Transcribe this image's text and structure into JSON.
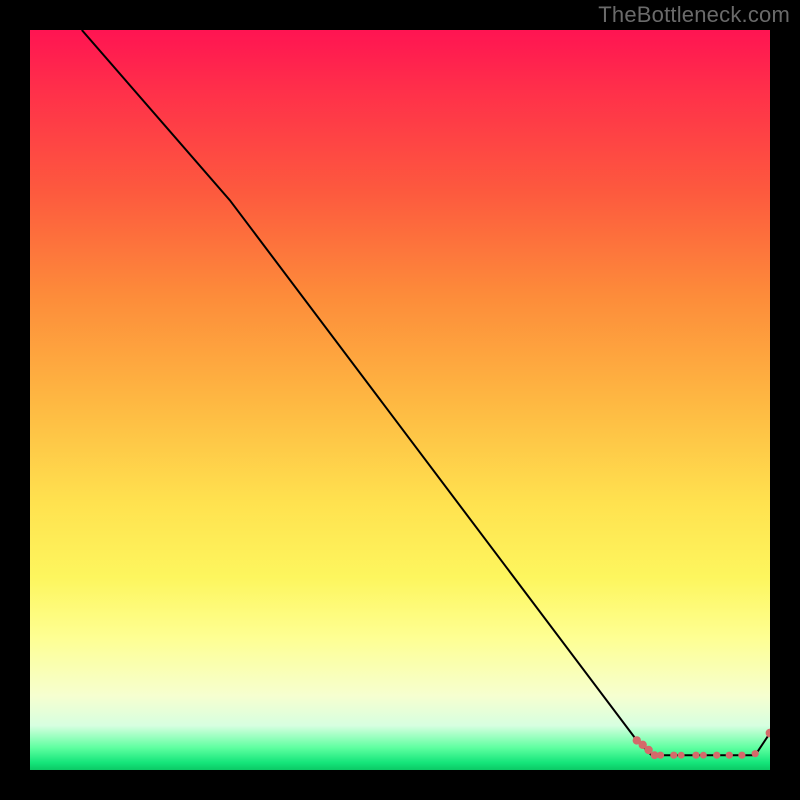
{
  "watermark": "TheBottleneck.com",
  "chart_data": {
    "type": "line",
    "title": "",
    "xlabel": "",
    "ylabel": "",
    "xlim": [
      0,
      100
    ],
    "ylim": [
      0,
      100
    ],
    "grid": false,
    "series": [
      {
        "name": "bottleneck-curve",
        "color": "#000000",
        "x": [
          7,
          27,
          82,
          84,
          98,
          100
        ],
        "y": [
          100,
          77,
          4,
          2,
          2,
          5
        ]
      }
    ],
    "markers": {
      "name": "highlight-points",
      "color": "#d46a6a",
      "points": [
        {
          "x": 82.0,
          "y": 4.0,
          "r": 3.2
        },
        {
          "x": 82.8,
          "y": 3.4,
          "r": 3.2
        },
        {
          "x": 83.6,
          "y": 2.7,
          "r": 3.2
        },
        {
          "x": 84.4,
          "y": 2.0,
          "r": 3.0
        },
        {
          "x": 85.2,
          "y": 2.0,
          "r": 2.8
        },
        {
          "x": 87.0,
          "y": 2.0,
          "r": 2.8
        },
        {
          "x": 88.0,
          "y": 2.0,
          "r": 2.6
        },
        {
          "x": 90.0,
          "y": 2.0,
          "r": 2.8
        },
        {
          "x": 91.0,
          "y": 2.0,
          "r": 2.6
        },
        {
          "x": 92.8,
          "y": 2.0,
          "r": 2.8
        },
        {
          "x": 94.5,
          "y": 2.0,
          "r": 2.8
        },
        {
          "x": 96.2,
          "y": 2.0,
          "r": 2.8
        },
        {
          "x": 98.0,
          "y": 2.2,
          "r": 2.8
        },
        {
          "x": 100.0,
          "y": 5.0,
          "r": 3.4
        }
      ]
    },
    "gradient_stops": [
      {
        "pos": 0,
        "color": "#ff1452"
      },
      {
        "pos": 22,
        "color": "#fd5a3e"
      },
      {
        "pos": 50,
        "color": "#feb742"
      },
      {
        "pos": 74,
        "color": "#fdf65e"
      },
      {
        "pos": 90,
        "color": "#f6ffd0"
      },
      {
        "pos": 97,
        "color": "#5effa0"
      },
      {
        "pos": 100,
        "color": "#0bc965"
      }
    ]
  }
}
